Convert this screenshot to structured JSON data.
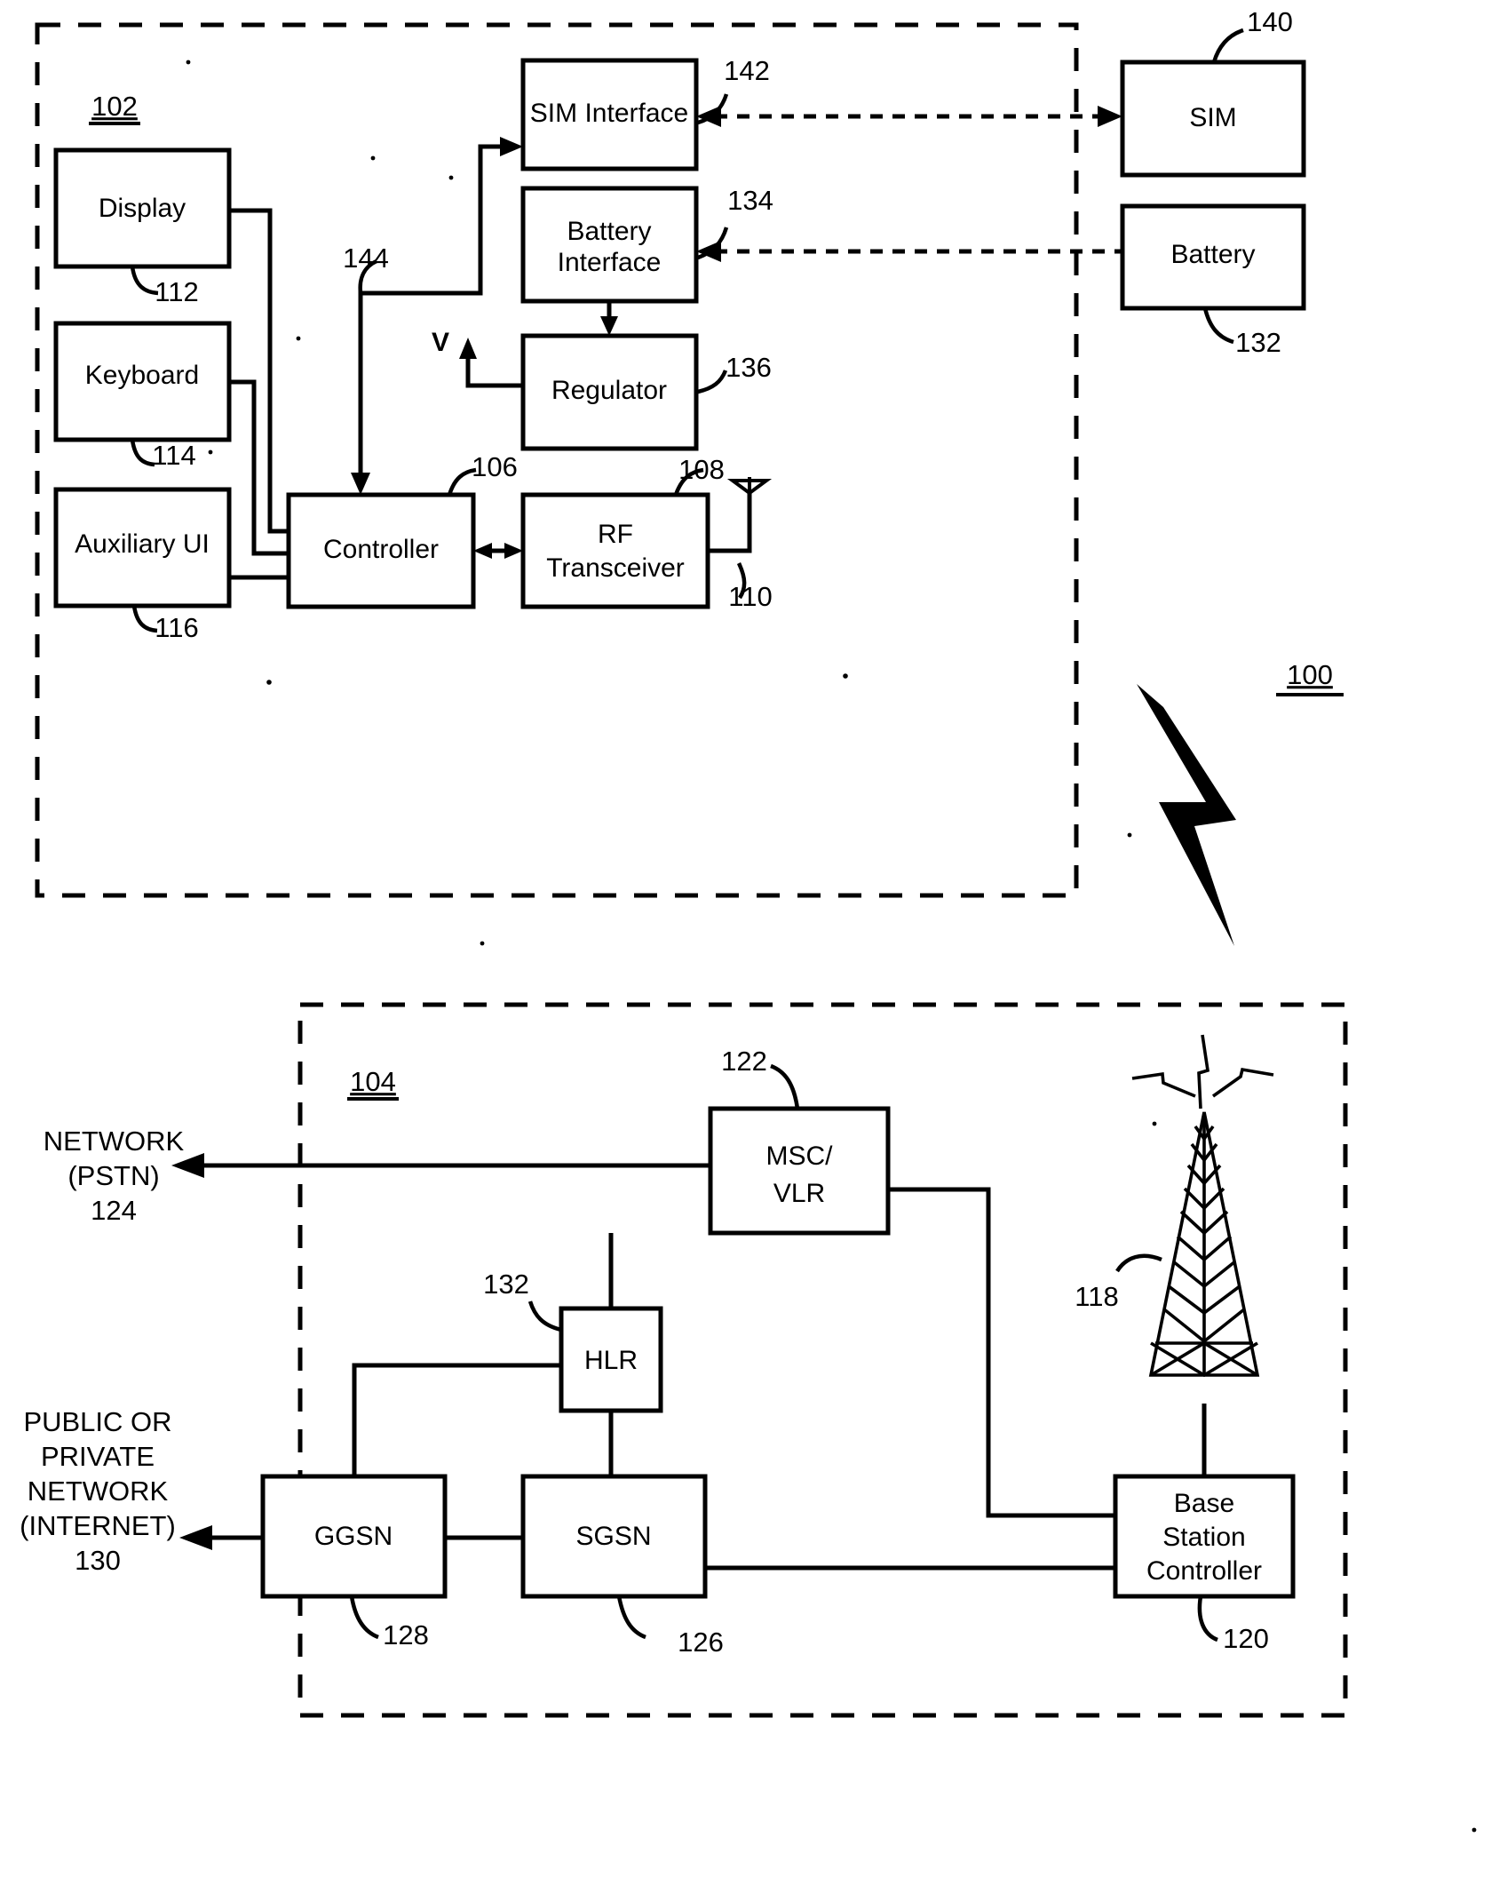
{
  "figure": {
    "type": "patent-block-diagram",
    "overall_ref": "100",
    "groups": [
      {
        "ref": "102",
        "name": "mobile-device-enclosure"
      },
      {
        "ref": "104",
        "name": "network-enclosure"
      }
    ],
    "mobile_device": {
      "enclosure_ref": "102",
      "blocks": [
        {
          "id": "display",
          "label": "Display",
          "ref": "112"
        },
        {
          "id": "keyboard",
          "label": "Keyboard",
          "ref": "114"
        },
        {
          "id": "auxiliary-ui",
          "label": "Auxiliary UI",
          "ref": "116"
        },
        {
          "id": "controller",
          "label": "Controller",
          "ref": "106"
        },
        {
          "id": "rf-transceiver",
          "label": "RF Transceiver",
          "ref": "108"
        },
        {
          "id": "sim-interface",
          "label": "SIM Interface",
          "ref": "142"
        },
        {
          "id": "battery-interface",
          "label": "Battery Interface",
          "ref": "134"
        },
        {
          "id": "regulator",
          "label": "Regulator",
          "ref": "136"
        }
      ],
      "antenna_ref": "110",
      "controller_bus_ref": "144",
      "regulator_output_label": "V"
    },
    "external_modules": [
      {
        "id": "sim",
        "label": "SIM",
        "ref": "140"
      },
      {
        "id": "battery",
        "label": "Battery",
        "ref": "132"
      }
    ],
    "network": {
      "enclosure_ref": "104",
      "blocks": [
        {
          "id": "msc-vlr",
          "label_line1": "MSC/",
          "label_line2": "VLR",
          "ref": "122"
        },
        {
          "id": "hlr",
          "label": "HLR",
          "ref": "132"
        },
        {
          "id": "ggsn",
          "label": "GGSN",
          "ref": "128"
        },
        {
          "id": "sgsn",
          "label": "SGSN",
          "ref": "126"
        },
        {
          "id": "base-station-controller",
          "label_line1": "Base",
          "label_line2": "Station",
          "label_line3": "Controller",
          "ref": "120"
        }
      ],
      "tower_ref": "118",
      "external_links": [
        {
          "id": "pstn-network",
          "lines": [
            "NETWORK",
            "(PSTN)"
          ],
          "ref": "124"
        },
        {
          "id": "internet-network",
          "lines": [
            "PUBLIC OR",
            "PRIVATE",
            "NETWORK",
            "(INTERNET)"
          ],
          "ref": "130"
        }
      ]
    },
    "colors": {
      "ink": "#000000",
      "paper": "#ffffff"
    }
  }
}
